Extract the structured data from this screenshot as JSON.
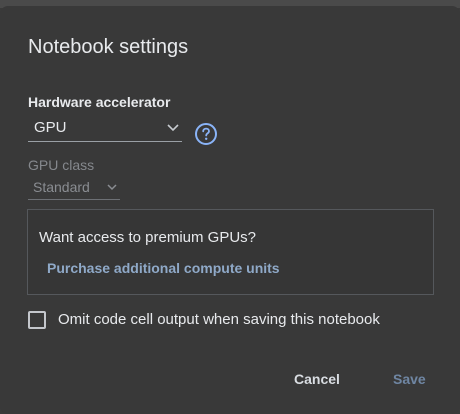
{
  "dialog": {
    "title": "Notebook settings",
    "hardware_accelerator": {
      "label": "Hardware accelerator",
      "value": "GPU",
      "help_icon": "help-circle-icon"
    },
    "gpu_class": {
      "label": "GPU class",
      "value": "Standard"
    },
    "promo": {
      "question": "Want access to premium GPUs?",
      "link": "Purchase additional compute units"
    },
    "omit_output": {
      "label": "Omit code cell output when saving this notebook",
      "checked": false
    },
    "buttons": {
      "cancel": "Cancel",
      "save": "Save"
    }
  },
  "colors": {
    "background": "#393939",
    "text": "#e8eaed",
    "dim_text": "#85888d",
    "link": "#8fa9c8",
    "save_disabled": "#6f86a3",
    "accent_icon": "#8ab4f8"
  }
}
